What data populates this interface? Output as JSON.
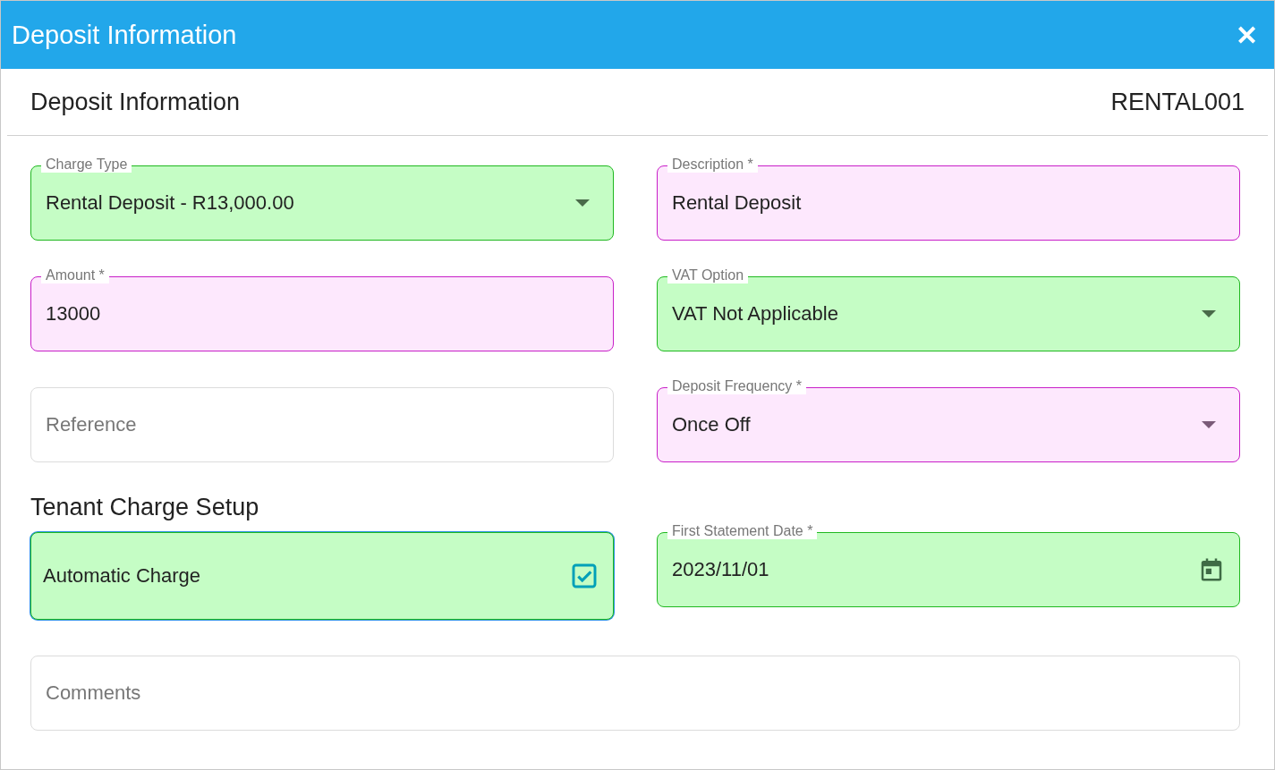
{
  "window": {
    "title": "Deposit Information",
    "close": "✕"
  },
  "sections": [
    {
      "title": "Deposit Information",
      "code": "RENTAL001",
      "rows": [
        {
          "fields": [
            {
              "kind": "select",
              "label": "Charge Type",
              "value": "Rental Deposit - R13,000.00",
              "color": "#c5fdc5"
            },
            {
              "kind": "text",
              "label": "Description *",
              "value": "Rental Deposit",
              "color": "#fde8fd"
            }
          ]
        },
        {
          "fields": [
            {
              "kind": "text",
              "label": "Amount *",
              "value": "13000",
              "color": "#fde8fd"
            },
            {
              "kind": "select",
              "label": "VAT Option",
              "value": "VAT Not Applicable",
              "color": "#c5fdc5"
            }
          ]
        },
        {
          "fields": [
            {
              "kind": "text",
              "placeholder": "Reference"
            },
            {
              "kind": "select",
              "label": "Deposit Frequency *",
              "value": "Once Off",
              "color": "#fde8fd"
            }
          ]
        }
      ]
    },
    {
      "title": "Tenant Charge Setup",
      "rows": [
        {
          "fields": [
            {
              "kind": "checkbox",
              "value": "Automatic Charge",
              "checked": true,
              "color": "#c5fdc5"
            },
            {
              "kind": "date",
              "label": "First Statement Date *",
              "value": "2023/11/01",
              "color": "#c5fdc5"
            }
          ]
        },
        {
          "fields": [
            {
              "kind": "text",
              "placeholder": "Comments"
            }
          ]
        }
      ]
    }
  ]
}
